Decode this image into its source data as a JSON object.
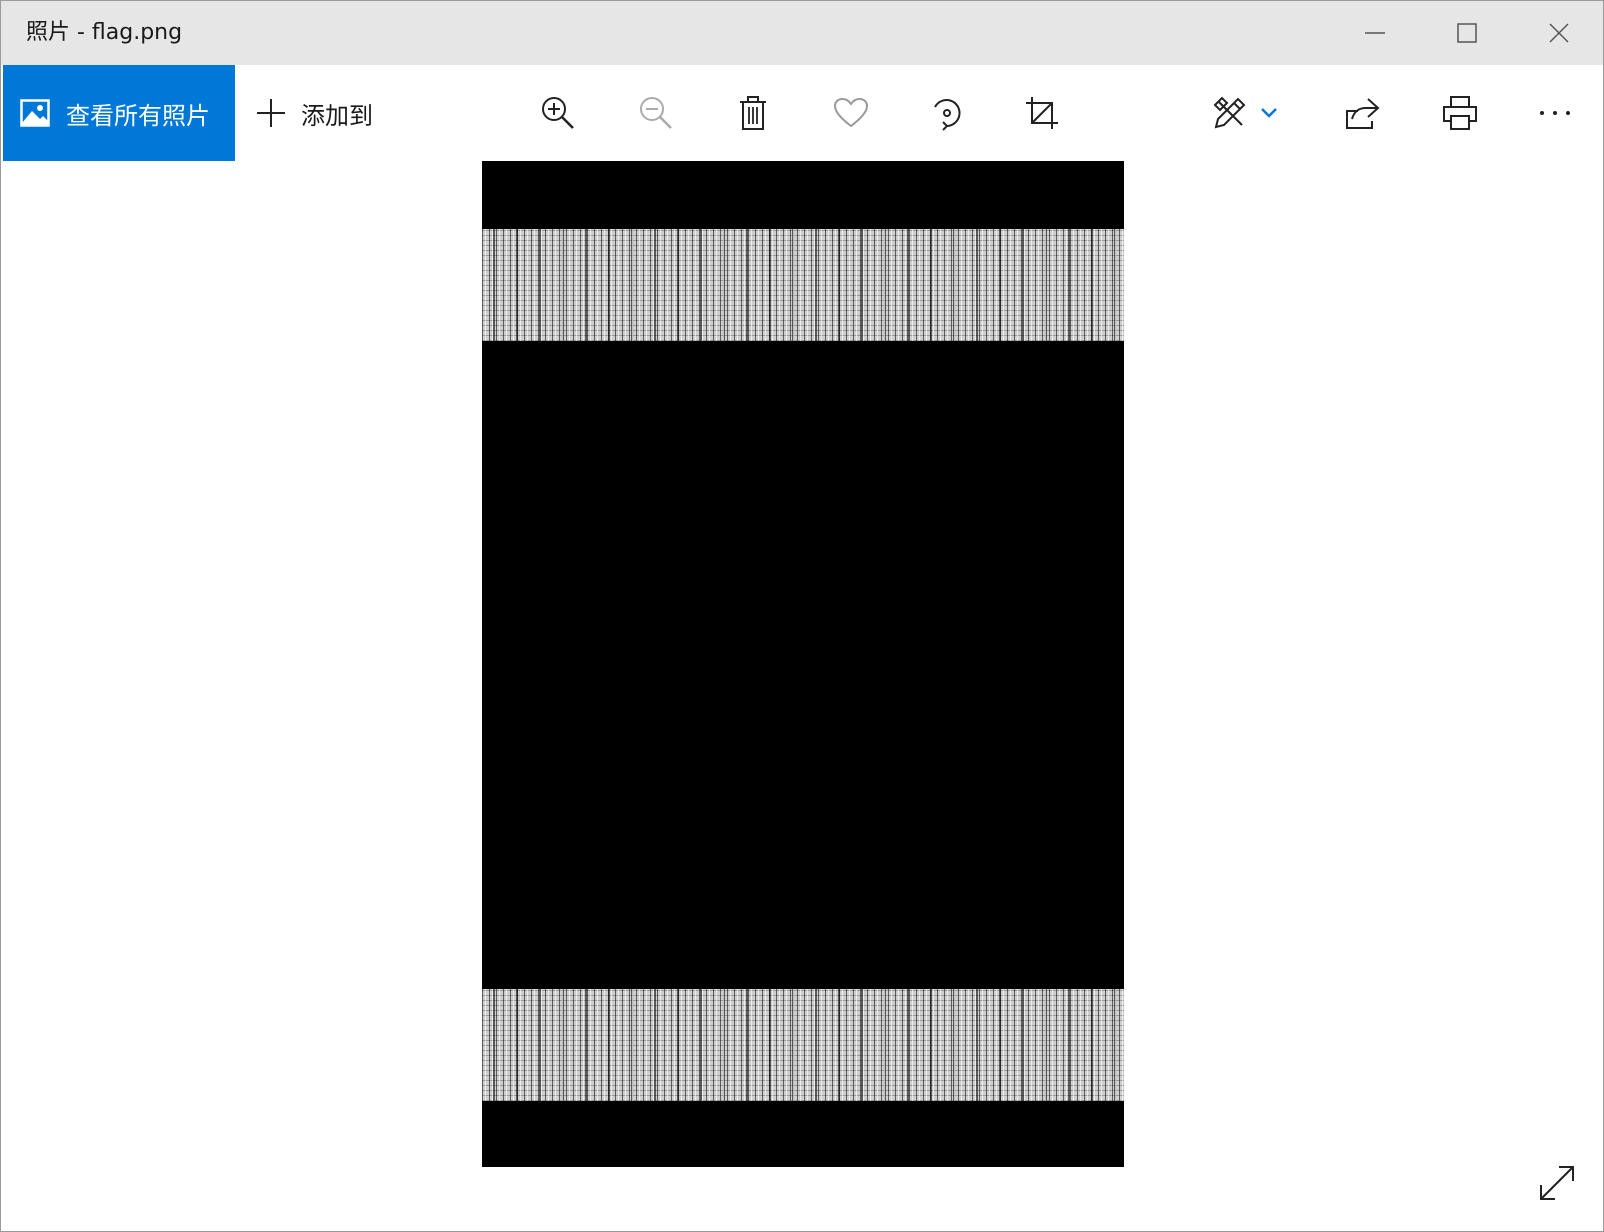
{
  "window": {
    "title": "照片 - flag.png"
  },
  "toolbar": {
    "view_all_label": "查看所有照片",
    "add_to_label": "添加到",
    "icons": [
      "zoom-in-icon",
      "zoom-out-icon",
      "delete-icon",
      "heart-icon",
      "rotate-icon",
      "crop-icon",
      "edit-draw-icon",
      "share-icon",
      "print-icon",
      "more-icon"
    ]
  },
  "colors": {
    "accent": "#0078d7",
    "titlebar": "#e6e6e6",
    "photo_background": "#000000"
  }
}
